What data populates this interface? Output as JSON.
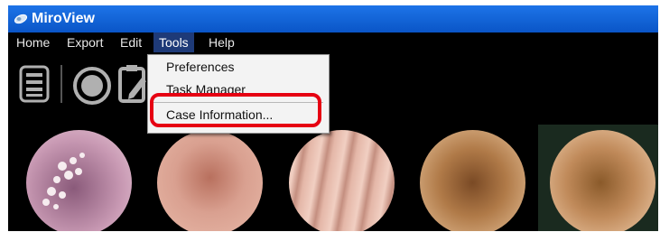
{
  "window": {
    "title": "MiroView",
    "icon": "app-logo-icon"
  },
  "menubar": {
    "items": [
      {
        "label": "Home"
      },
      {
        "label": "Export"
      },
      {
        "label": "Edit"
      },
      {
        "label": "Tools",
        "active": true
      },
      {
        "label": "Help"
      }
    ]
  },
  "toolbar": {
    "icons": [
      "list-document-icon",
      "record-circle-icon",
      "clipboard-edit-icon"
    ]
  },
  "tools_menu": {
    "items": [
      {
        "label": "Preferences"
      },
      {
        "label": "Task Manager"
      },
      {
        "label": "Case Information..."
      }
    ],
    "highlighted_item": "Case Information..."
  },
  "thumbnails": {
    "count": 5
  },
  "colors": {
    "titlebar": "#0a55c7",
    "menu_active": "#1e3a78",
    "dropdown_bg": "#f3f3f3",
    "highlight": "#e60012"
  }
}
